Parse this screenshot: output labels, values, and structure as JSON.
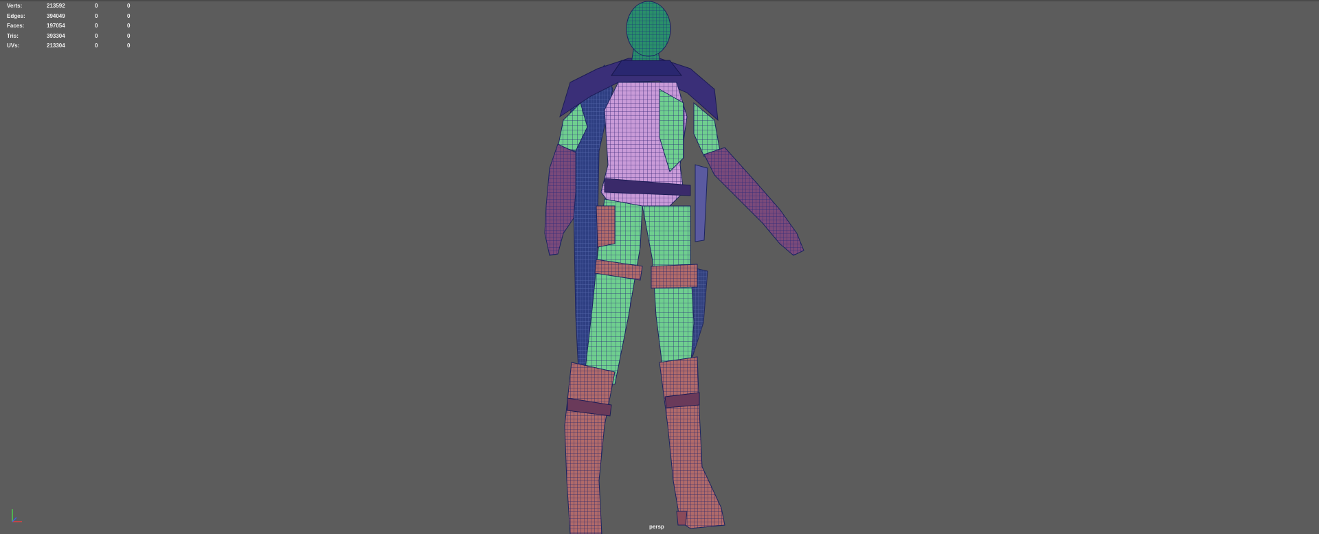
{
  "hud": {
    "rows": [
      {
        "label": "Verts:",
        "v1": "213592",
        "v2": "0",
        "v3": "0"
      },
      {
        "label": "Edges:",
        "v1": "394049",
        "v2": "0",
        "v3": "0"
      },
      {
        "label": "Faces:",
        "v1": "197054",
        "v2": "0",
        "v3": "0"
      },
      {
        "label": "Tris:",
        "v1": "393304",
        "v2": "0",
        "v3": "0"
      },
      {
        "label": "UVs:",
        "v1": "213304",
        "v2": "0",
        "v3": "0"
      }
    ]
  },
  "viewport": {
    "camera": "persp",
    "background": "#5c5c5c"
  },
  "colors": {
    "head": "#2a8f6a",
    "torso": "#c99bd8",
    "skin_green": "#6fcf8f",
    "boots": "#b06a6a",
    "wire": "#2a2a7a",
    "cape": "#2e3f82"
  },
  "icons": {
    "axis": "xyz-axis-icon"
  }
}
